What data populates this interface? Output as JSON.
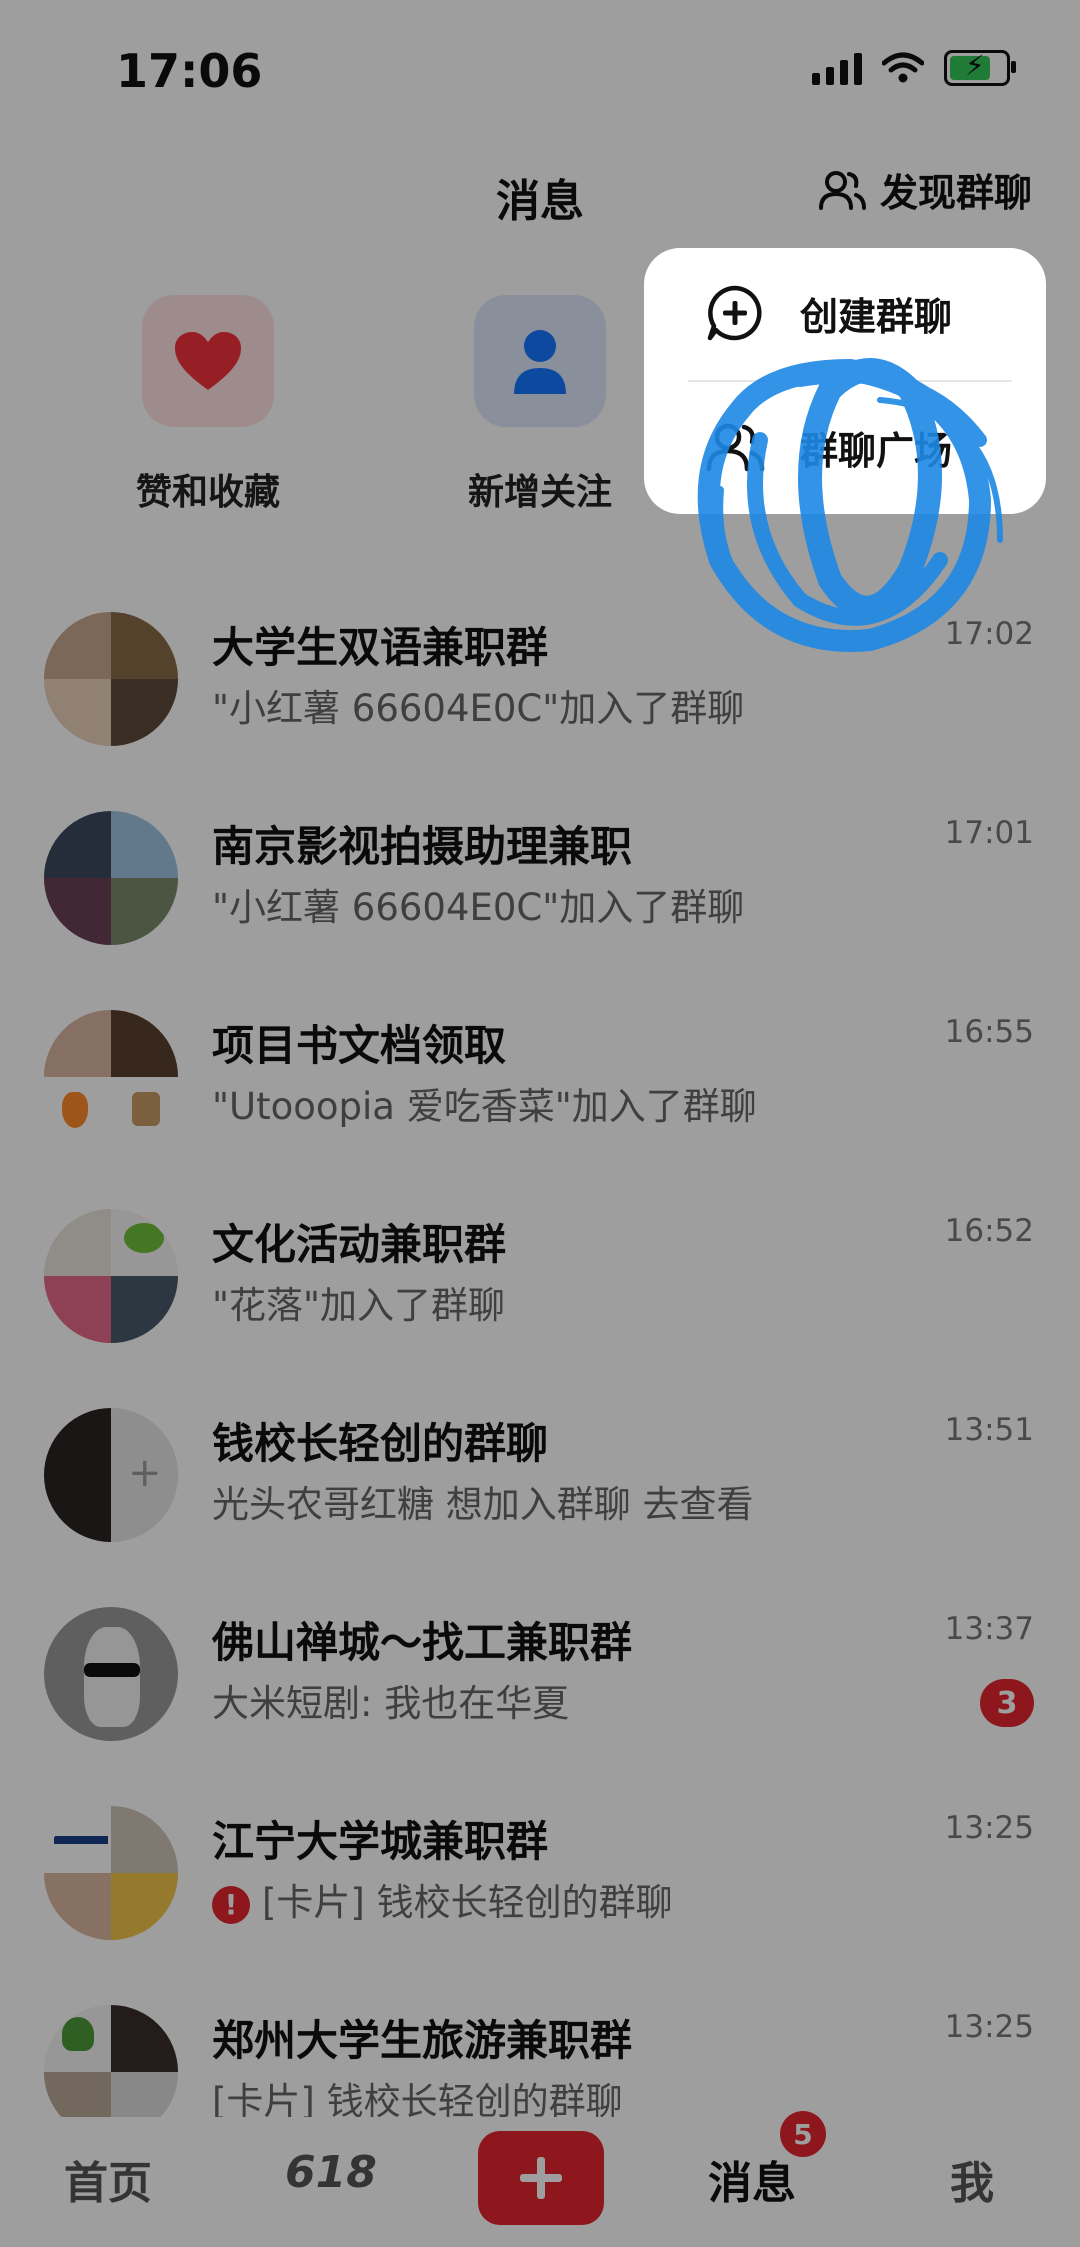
{
  "status_bar": {
    "time": "17:06"
  },
  "header": {
    "title": "消息",
    "discover_label": "发现群聊"
  },
  "quick_actions": [
    {
      "label": "赞和收藏",
      "icon": "heart-icon"
    },
    {
      "label": "新增关注",
      "icon": "person-icon"
    }
  ],
  "chats": [
    {
      "title": "大学生双语兼职群",
      "message": "\"小红薯 66604E0C\"加入了群聊",
      "time": "17:02"
    },
    {
      "title": "南京影视拍摄助理兼职",
      "message": "\"小红薯 66604E0C\"加入了群聊",
      "time": "17:01"
    },
    {
      "title": "项目书文档领取",
      "message": "\"Utooopia 爱吃香菜\"加入了群聊",
      "time": "16:55"
    },
    {
      "title": "文化活动兼职群",
      "message": "\"花落\"加入了群聊",
      "time": "16:52"
    },
    {
      "title": "钱校长轻创的群聊",
      "message": "光头农哥红糖 想加入群聊 去查看",
      "time": "13:51"
    },
    {
      "title": "佛山禅城～找工兼职群",
      "message": "大米短剧: 我也在华夏",
      "time": "13:37",
      "badge": "3"
    },
    {
      "title": "江宁大学城兼职群",
      "message": "[卡片] 钱校长轻创的群聊",
      "time": "13:25",
      "alert": "!"
    },
    {
      "title": "郑州大学生旅游兼职群",
      "message": "[卡片] 钱校长轻创的群聊",
      "time": "13:25"
    }
  ],
  "popup": {
    "items": [
      {
        "label": "创建群聊",
        "icon": "chat-plus-icon"
      },
      {
        "label": "群聊广场",
        "icon": "group-icon"
      }
    ]
  },
  "tabbar": {
    "items": [
      "首页",
      "618",
      "消息",
      "我"
    ],
    "active": "消息",
    "messages_badge": "5",
    "post_icon": "plus-icon"
  },
  "colors": {
    "brand_red": "#e5262f",
    "scribble_blue": "#1e88e5"
  }
}
